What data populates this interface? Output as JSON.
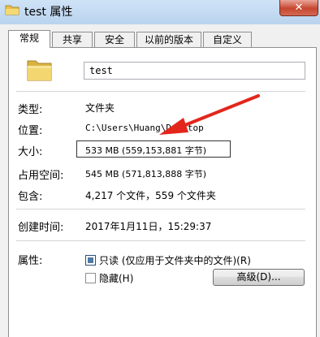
{
  "window": {
    "title": "test 属性",
    "close_glyph": "✕"
  },
  "tabs": [
    {
      "label": "常规",
      "active": true
    },
    {
      "label": "共享",
      "active": false
    },
    {
      "label": "安全",
      "active": false
    },
    {
      "label": "以前的版本",
      "active": false
    },
    {
      "label": "自定义",
      "active": false
    }
  ],
  "general": {
    "name_value": "test",
    "rows": {
      "type": {
        "label": "类型:",
        "value": "文件夹"
      },
      "location": {
        "label": "位置:",
        "value": "C:\\Users\\Huang\\Desktop"
      },
      "size": {
        "label": "大小:",
        "value": "533 MB (559,153,881 字节)"
      },
      "size_on_disk": {
        "label": "占用空间:",
        "value": "545 MB (571,813,888 字节)"
      },
      "contains": {
        "label": "包含:",
        "value": "4,217 个文件，559 个文件夹"
      },
      "created": {
        "label": "创建时间:",
        "value": "2017年1月11日，15:29:37"
      }
    },
    "attributes": {
      "label": "属性:",
      "readonly": {
        "label": "只读 (仅应用于文件夹中的文件)(R)",
        "state": "indeterminate"
      },
      "hidden": {
        "label": "隐藏(H)",
        "checked": false
      },
      "advanced_button": "高级(D)..."
    }
  },
  "colors": {
    "titlebar": "#b9d3ee",
    "close_button": "#c7462f",
    "annotation_arrow": "#e3261c",
    "checkbox_fill": "#4f79a6"
  },
  "icons": {
    "title": "folder-icon",
    "main": "folder-icon",
    "close": "close-icon"
  }
}
